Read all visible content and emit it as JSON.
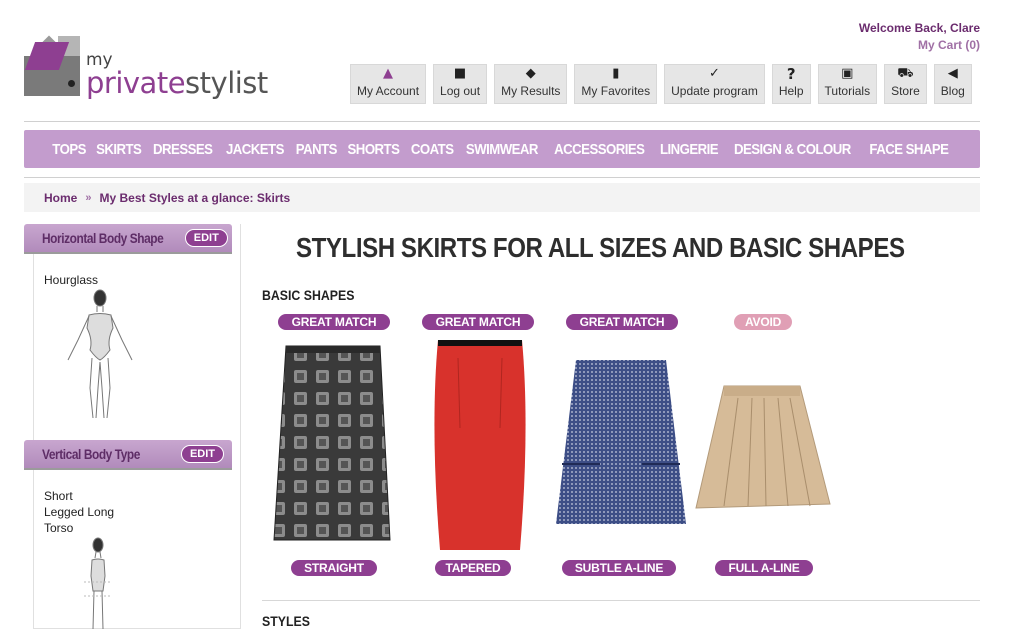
{
  "logo": {
    "my": "my",
    "private": "private",
    "stylist": "stylist"
  },
  "welcome": {
    "greeting": "Welcome Back, Clare",
    "cart": "My Cart (0)"
  },
  "toolbar": [
    {
      "label": "My Account",
      "icon": "user-icon",
      "glyph": "▲"
    },
    {
      "label": "Log out",
      "icon": "lock-icon",
      "glyph": "🔒"
    },
    {
      "label": "My Results",
      "icon": "tag-icon",
      "glyph": "◆"
    },
    {
      "label": "My Favorites",
      "icon": "document-icon",
      "glyph": "▮"
    },
    {
      "label": "Update program",
      "icon": "check-icon",
      "glyph": "✓"
    },
    {
      "label": "Help",
      "icon": "question-icon",
      "glyph": "?"
    },
    {
      "label": "Tutorials",
      "icon": "clapper-icon",
      "glyph": "▣"
    },
    {
      "label": "Store",
      "icon": "cart-icon",
      "glyph": "⛟"
    },
    {
      "label": "Blog",
      "icon": "megaphone-icon",
      "glyph": "◀"
    }
  ],
  "nav": [
    "TOPS",
    "SKIRTS",
    "DRESSES",
    "JACKETS",
    "PANTS",
    "SHORTS",
    "COATS",
    "SWIMWEAR",
    "ACCESSORIES",
    "LINGERIE",
    "DESIGN & COLOUR",
    "FACE SHAPE"
  ],
  "breadcrumb": {
    "home": "Home",
    "sep": "»",
    "current": "My Best Styles at a glance: Skirts"
  },
  "sidebar": {
    "horizontal": {
      "title": "Horizontal Body Shape",
      "edit": "EDIT",
      "value": "Hourglass"
    },
    "vertical": {
      "title": "Vertical Body Type",
      "edit": "EDIT",
      "value_lines": [
        "Short",
        "Legged Long",
        "Torso"
      ]
    }
  },
  "main": {
    "title": "STYLISH SKIRTS FOR ALL SIZES AND BASIC SHAPES",
    "basic_shapes": "BASIC SHAPES",
    "styles": "STYLES"
  },
  "skirts": [
    {
      "rating": "GREAT MATCH",
      "name": "STRAIGHT"
    },
    {
      "rating": "GREAT MATCH",
      "name": "TAPERED"
    },
    {
      "rating": "GREAT MATCH",
      "name": "SUBTLE A-LINE"
    },
    {
      "rating": "AVOID",
      "name": "FULL A-LINE"
    }
  ],
  "colors": {
    "brand": "#8e3f91",
    "nav": "#c39ccd",
    "avoid": "#e09fb5"
  }
}
